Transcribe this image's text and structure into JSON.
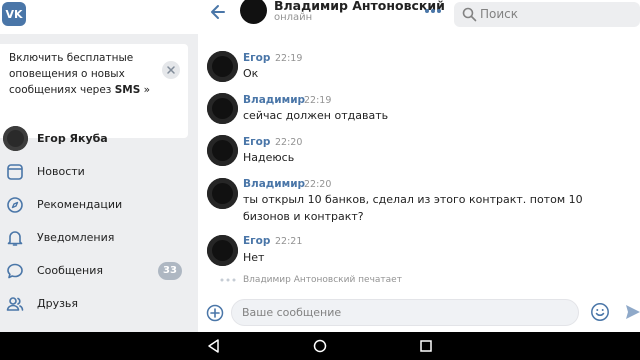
{
  "app": {
    "logo_text": "VK"
  },
  "header": {
    "contact_name": "Владимир Антоновский",
    "status": "онлайн",
    "search_placeholder": "Поиск"
  },
  "notification": {
    "text": "Включить бесплатные оповещения о новых сообщениях через ",
    "bold": "SMS",
    "suffix": " »"
  },
  "profile": {
    "name": "Егор Якуба"
  },
  "sidebar": {
    "items": [
      {
        "label": "Новости",
        "icon": "news-icon"
      },
      {
        "label": "Рекомендации",
        "icon": "compass-icon"
      },
      {
        "label": "Уведомления",
        "icon": "bell-icon"
      },
      {
        "label": "Сообщения",
        "icon": "chat-icon",
        "badge": "33"
      },
      {
        "label": "Друзья",
        "icon": "friends-icon"
      }
    ]
  },
  "chat": {
    "partial_text": "...",
    "messages": [
      {
        "author": "Егор",
        "time": "22:19",
        "text": "Ок"
      },
      {
        "author": "Владимир",
        "time": "22:19",
        "text": "сейчас должен отдавать"
      },
      {
        "author": "Егор",
        "time": "22:20",
        "text": "Надеюсь"
      },
      {
        "author": "Владимир",
        "time": "22:20",
        "text": "ты открыл 10 банков, сделал из этого контракт. потом 10 бизонов и контракт?"
      },
      {
        "author": "Егор",
        "time": "22:21",
        "text": "Нет"
      }
    ],
    "typing": "Владимир Антоновский печатает",
    "input_placeholder": "Ваше сообщение"
  },
  "colors": {
    "accent": "#4a76a8",
    "sidebar_bg": "#edeef0",
    "badge": "#aeb7c2"
  }
}
